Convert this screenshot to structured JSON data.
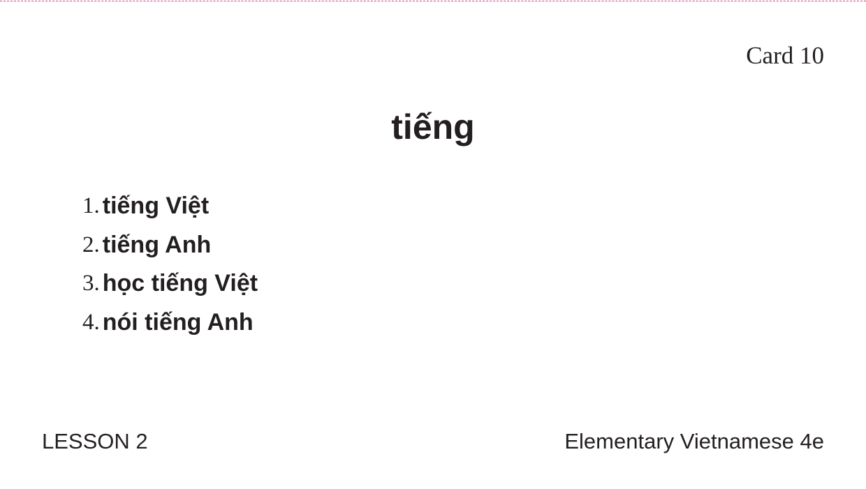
{
  "card": {
    "number_label": "Card 10",
    "headword": "tiếng",
    "examples": [
      {
        "num": "1.",
        "text": "tiếng Việt"
      },
      {
        "num": "2.",
        "text": "tiếng Anh"
      },
      {
        "num": "3.",
        "text": "học tiếng Việt"
      },
      {
        "num": "4.",
        "text": "nói tiếng Anh"
      }
    ]
  },
  "footer": {
    "lesson": "LESSON 2",
    "book": "Elementary Vietnamese 4e"
  },
  "colors": {
    "text": "#231f20",
    "cut_line": "#d6358a"
  }
}
